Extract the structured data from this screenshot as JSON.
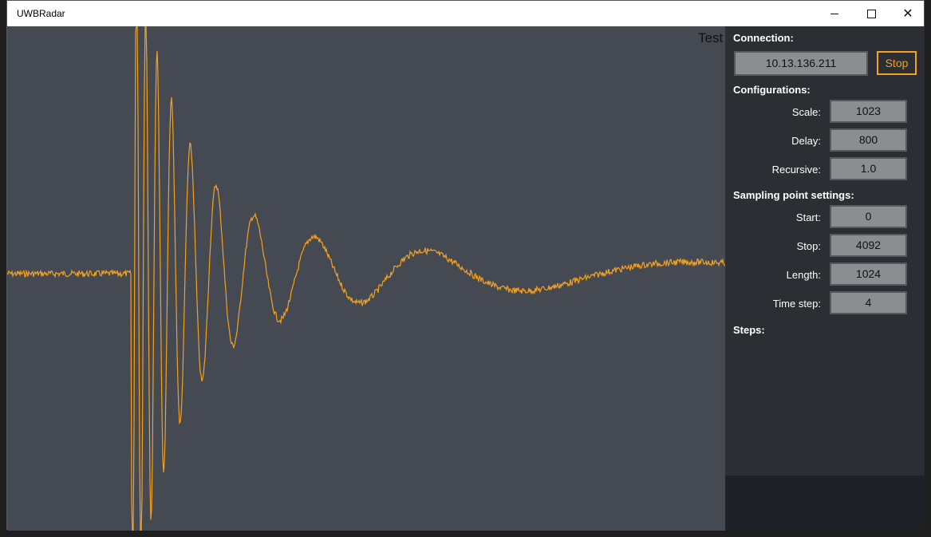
{
  "window": {
    "title": "UWBRadar"
  },
  "plot": {
    "title": "Test",
    "line_color": "#f4a020"
  },
  "connection": {
    "heading": "Connection:",
    "ip": "10.13.136.211",
    "stop_label": "Stop"
  },
  "configurations": {
    "heading": "Configurations:",
    "scale_label": "Scale:",
    "scale_value": "1023",
    "delay_label": "Delay:",
    "delay_value": "800",
    "recursive_label": "Recursive:",
    "recursive_value": "1.0"
  },
  "sampling": {
    "heading": "Sampling point settings:",
    "start_label": "Start:",
    "start_value": "0",
    "stop_label": "Stop:",
    "stop_value": "4092",
    "length_label": "Length:",
    "length_value": "1024",
    "timestep_label": "Time step:",
    "timestep_value": "4"
  },
  "steps": {
    "heading": "Steps:"
  },
  "colors": {
    "accent": "#f4a020",
    "panel_bg": "#2b2f34",
    "plot_bg": "#454a52"
  }
}
